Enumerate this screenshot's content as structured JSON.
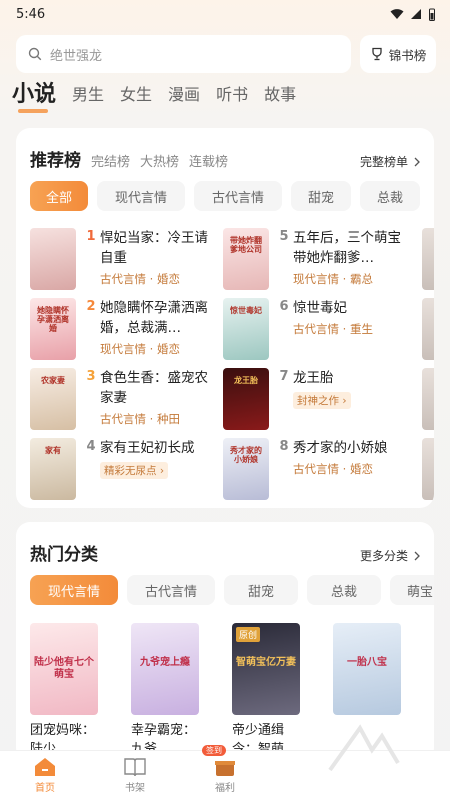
{
  "status_bar": {
    "time": "5:46",
    "icons": [
      "wifi-icon",
      "signal-icon",
      "battery-icon"
    ]
  },
  "search": {
    "placeholder": "绝世强龙",
    "icon": "search-icon"
  },
  "rank_button": {
    "label": "锦书榜",
    "icon": "trophy-icon"
  },
  "top_tabs": [
    "小说",
    "男生",
    "女生",
    "漫画",
    "听书",
    "故事"
  ],
  "recommend": {
    "title": "推荐榜",
    "sub_tabs": [
      "完结榜",
      "大热榜",
      "连载榜"
    ],
    "more": "完整榜单",
    "chips": [
      "全部",
      "现代言情",
      "古代言情",
      "甜宠",
      "总裁"
    ],
    "books": [
      {
        "rank": "1",
        "title": "悍妃当家：冷王请自重",
        "meta": "古代言情 · 婚恋",
        "cover_colors": [
          "#f6e1df",
          "#d9a7a5"
        ],
        "cover_text": "",
        "rank_color": "#f06a3a"
      },
      {
        "rank": "2",
        "title": "她隐瞒怀孕潇洒离婚，总裁满…",
        "meta": "现代言情 · 婚恋",
        "cover_colors": [
          "#fde8e8",
          "#e8a0a8"
        ],
        "cover_text": "她隐瞒怀孕潇洒离婚",
        "rank_color": "#f5883a"
      },
      {
        "rank": "3",
        "title": "食色生香：盛宠农家妻",
        "meta": "古代言情 · 种田",
        "cover_colors": [
          "#f7ede4",
          "#d6bfa4"
        ],
        "cover_text": "农家妻",
        "rank_color": "#f5a23a"
      },
      {
        "rank": "4",
        "title": "家有王妃初长成",
        "meta": "",
        "badge": "精彩无尿点 ›",
        "cover_colors": [
          "#f3ece0",
          "#cbb9a0"
        ],
        "cover_text": "家有",
        "rank_color": "#888"
      },
      {
        "rank": "5",
        "title": "五年后，三个萌宝带她炸翻爹…",
        "meta": "现代言情 · 霸总",
        "cover_colors": [
          "#fbe6e6",
          "#e6b7b6"
        ],
        "cover_text": "带她炸翻爹地公司",
        "rank_color": "#888"
      },
      {
        "rank": "6",
        "title": "惊世毒妃",
        "meta": "古代言情 · 重生",
        "cover_colors": [
          "#e7f2f0",
          "#9cc7c0"
        ],
        "cover_text": "惊世毒妃",
        "rank_color": "#888"
      },
      {
        "rank": "7",
        "title": "龙王胎",
        "meta": "",
        "badge": "封神之作 ›",
        "cover_colors": [
          "#3a0f0f",
          "#8a1a1a"
        ],
        "cover_text": "龙王胎",
        "rank_color": "#888"
      },
      {
        "rank": "8",
        "title": "秀才家的小娇娘",
        "meta": "古代言情 · 婚恋",
        "cover_colors": [
          "#eef0f6",
          "#b8bcd6"
        ],
        "cover_text": "秀才家的小娇娘",
        "rank_color": "#888"
      }
    ]
  },
  "hot": {
    "title": "热门分类",
    "more": "更多分类",
    "chips": [
      "现代言情",
      "古代言情",
      "甜宠",
      "总裁",
      "萌宝"
    ],
    "books": [
      {
        "title": "团宠妈咪：陆少…",
        "cover_colors": [
          "#fde9ea",
          "#f1b8c4"
        ],
        "cover_text": "陆少他有七个萌宝",
        "badge": ""
      },
      {
        "title": "幸孕霸宠：九爷…",
        "cover_colors": [
          "#efe6f6",
          "#c8b0e0"
        ],
        "cover_text": "九爷宠上瘾",
        "badge": ""
      },
      {
        "title": "帝少通缉令：智萌…",
        "cover_colors": [
          "#2a2a38",
          "#6d6a7e"
        ],
        "cover_text": "智萌宝亿万妻",
        "badge": "原创"
      },
      {
        "title": "",
        "cover_colors": [
          "#e6eef7",
          "#b6c9df"
        ],
        "cover_text": "一胎八宝",
        "badge": ""
      }
    ]
  },
  "bottom_nav": [
    {
      "label": "首页",
      "icon": "home-icon",
      "active": true
    },
    {
      "label": "书架",
      "icon": "bookshelf-icon",
      "active": false
    },
    {
      "label": "福利",
      "icon": "gift-icon",
      "active": false,
      "badge": "签到"
    }
  ]
}
